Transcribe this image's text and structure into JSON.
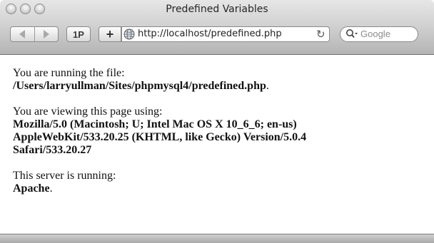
{
  "window": {
    "title": "Predefined Variables"
  },
  "toolbar": {
    "back_icon": "back-triangle",
    "forward_icon": "forward-triangle",
    "onepassword_label": "1P",
    "add_label": "+",
    "url": "http://localhost/predefined.php",
    "reload_glyph": "↻",
    "search_placeholder": "Google"
  },
  "content": {
    "p1_text": "You are running the file:",
    "p1_path": "/Users/larryullman/Sites/phpmysql4/predefined.php",
    "p1_end": ".",
    "p2_text": "You are viewing this page using:",
    "p2_ua_line1": "Mozilla/5.0 (Macintosh; U; Intel Mac OS X 10_6_6; en-us)",
    "p2_ua_line2": "AppleWebKit/533.20.25 (KHTML, like Gecko) Version/5.0.4",
    "p2_ua_line3": "Safari/533.20.27",
    "p3_text": "This server is running:",
    "p3_server": "Apache",
    "p3_end": "."
  },
  "colors": {
    "titlebar_top": "#e6e6e6",
    "titlebar_bottom": "#b4b4b4",
    "page_bg": "#ffffff",
    "text": "#111111"
  }
}
